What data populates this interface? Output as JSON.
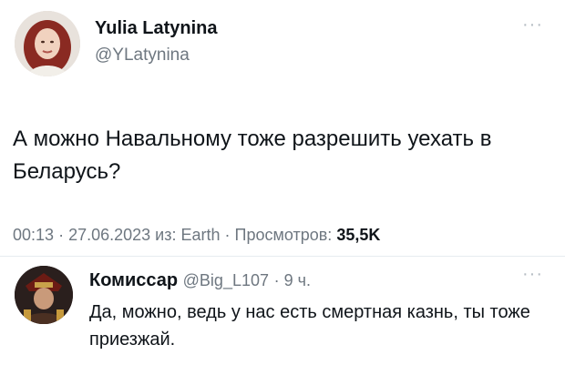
{
  "tweet": {
    "author_name": "Yulia Latynina",
    "author_handle": "@YLatynina",
    "text": "А можно Навальному тоже разрешить уехать в Беларусь?",
    "time": "00:13",
    "date": "27.06.2023",
    "source": "из: Earth",
    "views_label": "Просмотров:",
    "views_count": "35,5K",
    "more_icon": "more-horizontal-icon"
  },
  "reply": {
    "author_name": "Комиссар",
    "author_handle": "@Big_L107",
    "age": "9 ч.",
    "text": "Да, можно, ведь у нас есть смертная казнь, ты тоже приезжай.",
    "more_icon": "more-horizontal-icon"
  },
  "colors": {
    "text": "#0f1419",
    "muted": "#6e7780",
    "divider": "#e6ecf0"
  }
}
